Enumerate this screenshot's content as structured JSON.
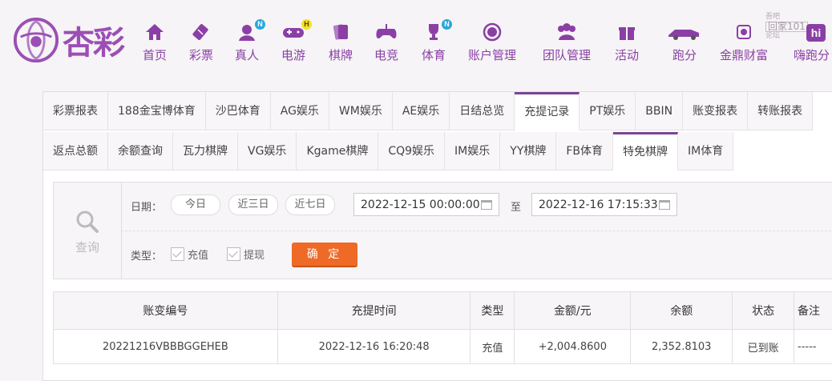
{
  "brand": {
    "name": "杏彩"
  },
  "nav": [
    {
      "label": "首页",
      "icon": "home-icon",
      "badge": ""
    },
    {
      "label": "彩票",
      "icon": "lottery-ticket-icon",
      "badge": ""
    },
    {
      "label": "真人",
      "icon": "live-dealer-icon",
      "badge": "N"
    },
    {
      "label": "电游",
      "icon": "gamepad-icon",
      "badge": "H"
    },
    {
      "label": "棋牌",
      "icon": "playing-cards-icon",
      "badge": ""
    },
    {
      "label": "电竞",
      "icon": "esports-controller-icon",
      "badge": ""
    },
    {
      "label": "体育",
      "icon": "trophy-icon",
      "badge": "N"
    },
    {
      "label": "账户管理",
      "icon": "account-coin-icon",
      "badge": ""
    },
    {
      "label": "团队管理",
      "icon": "team-icon",
      "badge": ""
    },
    {
      "label": "活动",
      "icon": "gift-icon",
      "badge": ""
    },
    {
      "label": "跑分",
      "icon": "race-car-icon",
      "badge": ""
    },
    {
      "label": "金鼎财富",
      "icon": "treasure-icon",
      "badge": ""
    },
    {
      "label": "嗨跑分",
      "icon": "hi-icon",
      "badge": ""
    }
  ],
  "watermark": {
    "line1": "吾吧",
    "line2": "回家101",
    "line3": "论坛"
  },
  "tabs_row1": [
    "彩票报表",
    "188金宝博体育",
    "沙巴体育",
    "AG娱乐",
    "WM娱乐",
    "AE娱乐",
    "日结总览",
    "充提记录",
    "PT娱乐",
    "BBIN",
    "账变报表",
    "转账报表"
  ],
  "tabs_row2": [
    "返点总额",
    "余额查询",
    "瓦力棋牌",
    "VG娱乐",
    "Kgame棋牌",
    "CQ9娱乐",
    "IM娱乐",
    "YY棋牌",
    "FB体育",
    "特免棋牌",
    "IM体育"
  ],
  "active_tab_row1": "充提记录",
  "active_tab_row2": "特免棋牌",
  "filter": {
    "query_label": "查询",
    "date_label": "日期：",
    "quick_ranges": [
      "今日",
      "近三日",
      "近七日"
    ],
    "start": "2022-12-15 00:00:00",
    "to_label": "至",
    "end": "2022-12-16 17:15:33",
    "type_label": "类型：",
    "types": [
      "充值",
      "提现"
    ],
    "confirm": "确 定"
  },
  "table": {
    "headers": [
      "账变编号",
      "充提时间",
      "类型",
      "金额/元",
      "余额",
      "状态",
      "备注"
    ],
    "rows": [
      [
        "20221216VBBBGGEHEB",
        "2022-12-16 16:20:48",
        "充值",
        "+2,004.8600",
        "2,352.8103",
        "已到账",
        "-----"
      ]
    ]
  },
  "colors": {
    "brand": "#8b3fa6",
    "accent": "#ee6a26",
    "positive": "#d0202a",
    "status_ok": "#2ea02e"
  }
}
